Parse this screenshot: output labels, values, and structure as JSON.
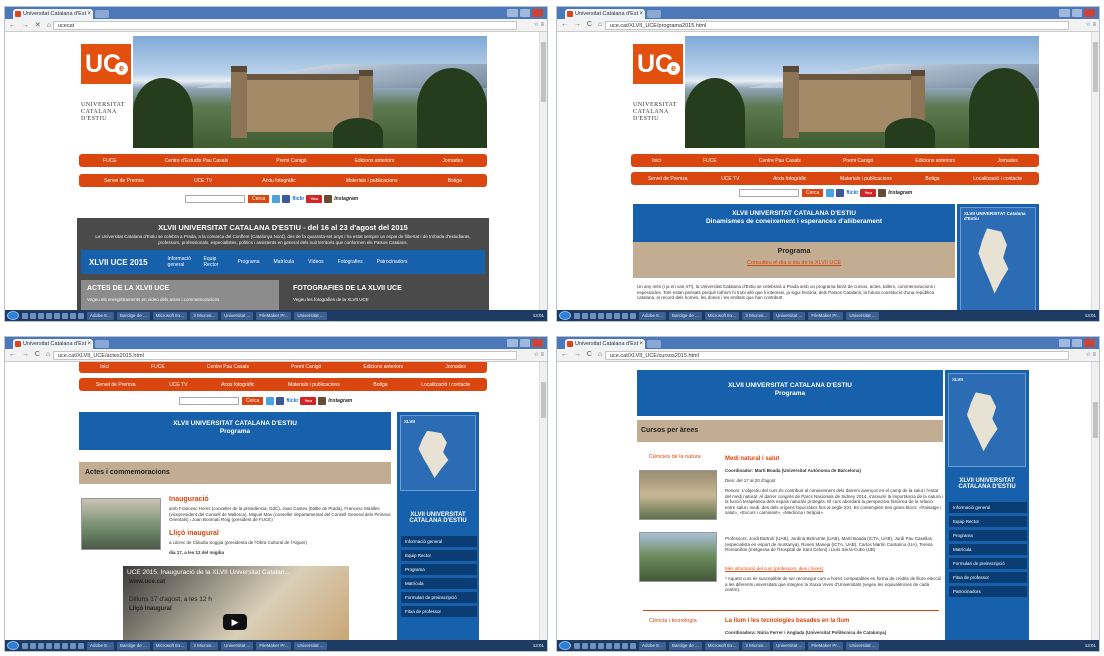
{
  "shared": {
    "tab_title": "Universitat Catalana d'Est",
    "logo_text": "UC",
    "logo_e": "e",
    "logo_line1": "UNIVERSITAT",
    "logo_line2": "CATALANA",
    "logo_line3": "D'ESTIU",
    "search_button": "Cerca",
    "flickr": "flickr",
    "youtube": "You Tube",
    "instagram": "Instagram",
    "taskbar": [
      "Adobe E...",
      "Barolge de ...",
      "Microsoft Ex...",
      "2 Microsi...",
      "Universitat ...",
      "FileMaker Pr...",
      "Universitat ..."
    ],
    "clock": "13:01"
  },
  "q1": {
    "url": "ucecat",
    "menu1": [
      "FUCE",
      "Centre d'Estudis Pau Casals",
      "Premi Canigó",
      "Edicions anteriors",
      "Jornades"
    ],
    "menu2": [
      "Servei de Premsa",
      "UCE TV",
      "Arxiu fotogràfic",
      "Materials i publicacions",
      "Botiga"
    ],
    "headline": "XLVII UNIVERSITAT CATALANA D'ESTIU - del 16 al 23 d'agost del 2015",
    "intro": "La Universitat Catalana d'Estiu se celebra a Prada, a la comarca del Conflent (Catalunya Nord), des de fa quaranta-set anys i ha estat sempre un espai de llibertat i de trobada d'estudiants, professors, professionals, especialistes, polítics i assistents en general dels nuit territoris que conformen els Països Catalans.",
    "bar_title": "XLVII UCE 2015",
    "bar_items": [
      "Informació general",
      "Equip Rector",
      "Programa",
      "Matrícula",
      "Vídeos",
      "Fotografies",
      "Patrocinadors"
    ],
    "box1_title": "ACTES DE LA XLVII UCE",
    "box1_text": "Vegeu els enregistraments en vídeo dels actes i commemoracions",
    "box2_title": "FOTOGRAFIES DE LA XLVII UCE",
    "box2_text": "Vegeu les fotografies de la XLVII UCE"
  },
  "q2": {
    "url": "uce.cat/XLVII_UCE/programa2015.html",
    "menu1": [
      "Inici",
      "FUCE",
      "Centre Pau Casals",
      "Premi Canigó",
      "Edicions anteriors",
      "Jornades"
    ],
    "menu2": [
      "Servei de Premsa",
      "UCE TV",
      "Arxiu fotogràfic",
      "Materials i publicacions",
      "Botiga",
      "Localització i contacte"
    ],
    "head1": "XLVII UNIVERSITAT CATALANA D'ESTIU",
    "head2": "Dinamismes de coneixement i esperances d'alliberament",
    "band_title": "Programa",
    "band_link": "Consulteu el dia a dia de la XLVII UCE",
    "body": "Un any més (i ja en van 47!), la Universitat Catalana d'Estiu se celebrarà a Prada amb un programa farcit de cursos, actes, tallers, commemoracions i espectacles. Tots estan pensats perquè tothom hi trobi allò que li interessi, ja sigui història, dels Països Catalans, la futura constitució d'una república catalana, el record dels homes, les dones i les entitats que han contribuït",
    "map_title": "XLVII UNIVERSITAT Catalana d'Estiu"
  },
  "q3": {
    "url": "uce.cat/XLVII_UCE/actes2015.html",
    "menu1": [
      "Inici",
      "FUCE",
      "Centre Pau Casals",
      "Premi Canigó",
      "Edicions anteriors",
      "Jornades"
    ],
    "menu2": [
      "Servei de Premsa",
      "UCE TV",
      "Arxiu fotogràfic",
      "Materials i publicacions",
      "Botiga",
      "Localització i contacte"
    ],
    "head1": "XLVII UNIVERSITAT CATALANA D'ESTIU",
    "head2": "Programa",
    "band_title": "Actes i commemoracions",
    "item1_title": "Inauguració",
    "item1_text": "amb Francesc Homs (conseller de la presidència, GdC), Joan Castex (batlle de Prada), Francesc Miralles (vicepresident del Consell de Mallorca), Miquel Mas (conseller departamental del Consell General dels Pirineus Orientals) i Joan Bonmatí Roig (president de FUCE)",
    "item2_title": "Lliçó inaugural",
    "item2_text": "a càrrec de Clàudia Soggia (presidenta de l'Obra Cultural de l'Alguer)",
    "item2_date": "dia 17, a les 12 del migdia",
    "video_title": "UCE 2015. Inauguració de la XLVII Universitat Catalan...",
    "video_site": "www.uce.cat",
    "video_line1": "Dilluns 17 d'agost, a les 12 h",
    "video_line2": "Lliçó inaugural",
    "side_title": "XLVII UNIVERSITAT CATALANA D'ESTIU",
    "side_nav": [
      "Informació general",
      "Equip Rector",
      "Programa",
      "Matrícula",
      "Formulari de preinscripció",
      "Fitxa de professor"
    ]
  },
  "q4": {
    "url": "uce.cat/XLVII_UCE/cursos2015.html",
    "head1": "XLVII UNIVERSITAT CATALANA D'ESTIU",
    "head2": "Programa",
    "band_title": "Cursos per àrees",
    "cat1": "Ciències de la natura",
    "course1_title": "Medi natural i salut",
    "course1_coord": "Coordinador: Martí Boada (Universitat Autònoma de Barcelona)",
    "course1_dies": "Dies: del 17 al 20 d'agost",
    "course1_resum": "Resum: L'objectiu del curs és contribuir al coneixement dels darrers avenços en el camp de la salut i l'estat del medi natural. Al darrer congrés de Parcs Nacionals de Sidney 2014, s'assumí la importància de la natura i la funció terapèutica dels espais naturals protegits. El curs abordarà la perspectiva històrica de la relació entre salut i medi, des dels orígens hipocràtics fins al segle XXI. Es contemplen tres grans blocs: «Paisatge i salut», «Excurs i caminant», «Medicina i teràpia».",
    "course1_prof": "Professors: Jordi Bartrolí (UAB), Jordina Belmonte (UAB), Martí Boada (ICTA, UAB), Jordi Pau Casellas (especialista en esport de muntanya), Rosen Maneja (ICTA, UAB), Carlos Martin Cantarino (UA), Teresa Romanillos (metgessa de l'Hospital de Sant Celoni) i Lluís Serra-Cobo (UB)",
    "course1_link": "Més informació del curs (professors, dies i hores)",
    "course1_note": "* Aquest curs és susceptible de ser reconegut com a hores computables en forma de crèdits de lliure elecció a les diferents universitats que integren la Xarxa Vives d'Universitats (vegeu les equivalències de cada centre).",
    "cat2": "Ciència i tecnologia",
    "course2_title": "La llum i les tecnologies basades en la llum",
    "course2_coord": "Coordinadora: Núria Ferrer i Anglada (Universitat Politècnica de Catalunya)",
    "side_title": "XLVII UNIVERSITAT CATALANA D'ESTIU",
    "side_nav": [
      "Informació general",
      "Equip Rector",
      "Programa",
      "Matrícula",
      "Formulari de preinscripció",
      "Fitxa de professor",
      "Patrocinadors"
    ]
  }
}
